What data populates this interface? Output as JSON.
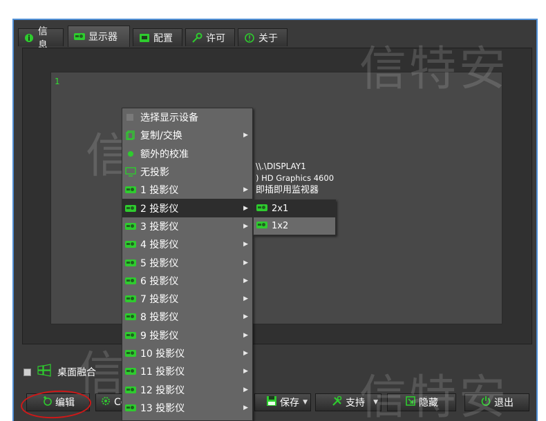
{
  "tabs": [
    {
      "label": "信息",
      "icon": "info-icon"
    },
    {
      "label": "显示器",
      "icon": "projector-icon",
      "active": true
    },
    {
      "label": "配置",
      "icon": "config-icon"
    },
    {
      "label": "许可",
      "icon": "key-icon"
    },
    {
      "label": "关于",
      "icon": "about-icon"
    }
  ],
  "watermark": "信特安",
  "display": {
    "number": "1",
    "line1": "\\\\.\\DISPLAY1",
    "line2": ") HD Graphics 4600",
    "line3": "即插即用监视器"
  },
  "menu": {
    "items": [
      {
        "label": "选择显示设备",
        "icon": "select-device-icon"
      },
      {
        "label": "复制/交换",
        "icon": "copy-icon",
        "submenu": true
      },
      {
        "label": "额外的校准",
        "icon": "radio-dot-icon"
      },
      {
        "label": "无投影",
        "icon": "monitor-icon"
      },
      {
        "label": "1 投影仪",
        "icon": "projector-icon",
        "submenu": true
      },
      {
        "label": "2 投影仪",
        "icon": "projector-icon",
        "submenu": true,
        "highlighted": true
      },
      {
        "label": "3 投影仪",
        "icon": "projector-icon",
        "submenu": true
      },
      {
        "label": "4 投影仪",
        "icon": "projector-icon",
        "submenu": true
      },
      {
        "label": "5 投影仪",
        "icon": "projector-icon",
        "submenu": true
      },
      {
        "label": "6 投影仪",
        "icon": "projector-icon",
        "submenu": true
      },
      {
        "label": "7 投影仪",
        "icon": "projector-icon",
        "submenu": true
      },
      {
        "label": "8 投影仪",
        "icon": "projector-icon",
        "submenu": true
      },
      {
        "label": "9 投影仪",
        "icon": "projector-icon",
        "submenu": true
      },
      {
        "label": "10 投影仪",
        "icon": "projector-icon",
        "submenu": true
      },
      {
        "label": "11 投影仪",
        "icon": "projector-icon",
        "submenu": true
      },
      {
        "label": "12 投影仪",
        "icon": "projector-icon",
        "submenu": true
      },
      {
        "label": "13 投影仪",
        "icon": "projector-icon",
        "submenu": true
      }
    ]
  },
  "submenu": {
    "items": [
      {
        "label": "2x1",
        "highlighted": true
      },
      {
        "label": "1x2"
      }
    ]
  },
  "blend": {
    "label": "桌面融合"
  },
  "buttons": {
    "edit": "编辑",
    "co": "Co",
    "save": "保存",
    "support": "支持",
    "hide": "隐藏",
    "exit": "退出"
  },
  "colors": {
    "accent": "#2ecc2e",
    "annotation": "#d01818",
    "window_border": "#4f8fd6"
  }
}
